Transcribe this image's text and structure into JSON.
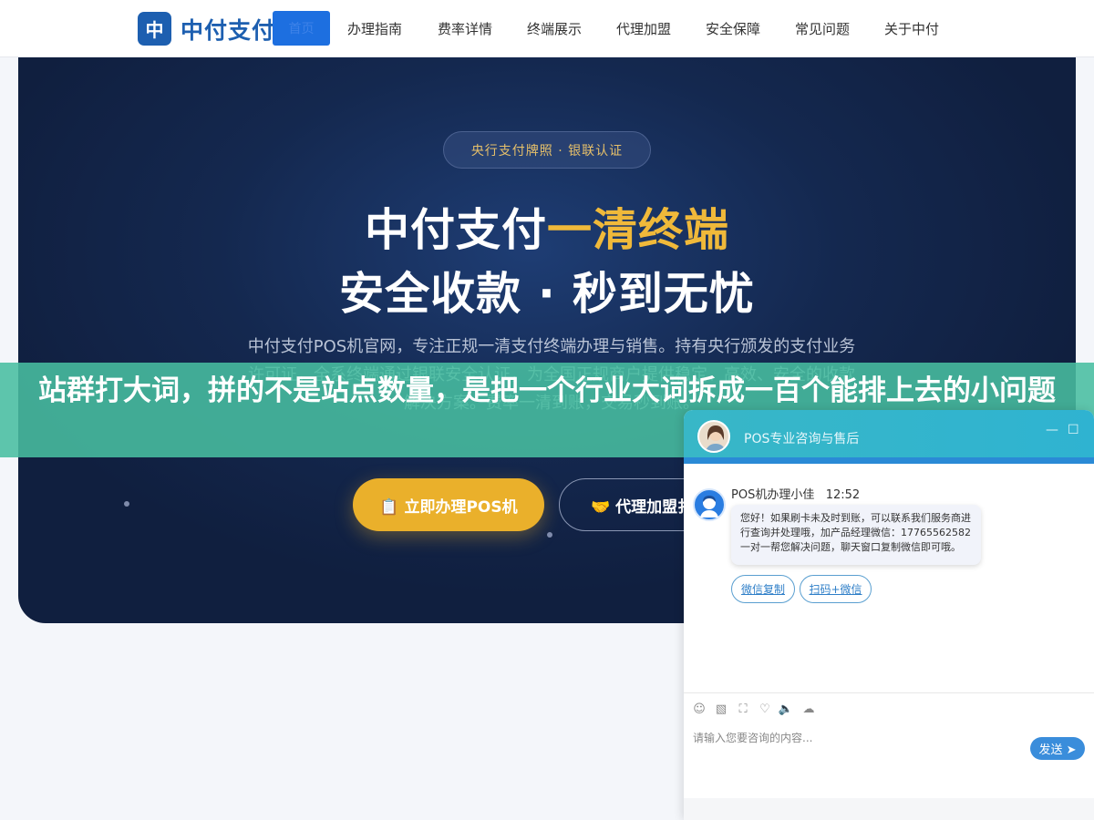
{
  "nav": {
    "logo_mark": "中",
    "logo_text": "中付支付",
    "home": "首页",
    "items": [
      "办理指南",
      "费率详情",
      "终端展示",
      "代理加盟",
      "安全保障",
      "常见问题",
      "关于中付"
    ]
  },
  "hero": {
    "badge": "央行支付牌照 · 银联认证",
    "title_main": "中付支付",
    "title_highlight": "一清终端",
    "title_line2": "安全收款 · 秒到无忧",
    "desc": "中付支付POS机官网，专注正规一清支付终端办理与销售。持有央行颁发的支付业务许可证，全系终端通过银联安全认证，为全国正规商户提供稳定、高效、安全的收款解决方案。费率一清到账，交易秒到账。",
    "btn_apply": "📋 立即办理POS机",
    "btn_agent": "🤝 代理加盟扌"
  },
  "banner": {
    "text": "站群打大词，拼的不是站点数量，是把一个行业大词拆成一百个能排上去的小问题"
  },
  "chat": {
    "title": "POS专业咨询与售后",
    "minimize": "—",
    "maximize": "☐",
    "agent_name": "POS机办理小佳",
    "time": "12:52",
    "message": "您好！如果刷卡未及时到账，可以联系我们服务商进行查询并处理哦，加产品经理微信：17765562582 一对一帮您解决问题，聊天窗口复制微信即可哦。",
    "quick_replies": [
      "微信复制",
      "扫码+微信"
    ],
    "tools": [
      "emoji-icon",
      "image-icon",
      "screenshot-icon",
      "rate-icon",
      "voice-icon",
      "wechat-icon"
    ],
    "placeholder": "请输入您要咨询的内容...",
    "send": "发送 ➤"
  },
  "colors": {
    "brand": "#1d5fb0",
    "accent": "#eab02b",
    "banner": "#48bea0",
    "chat_header": "#38b7c7"
  }
}
